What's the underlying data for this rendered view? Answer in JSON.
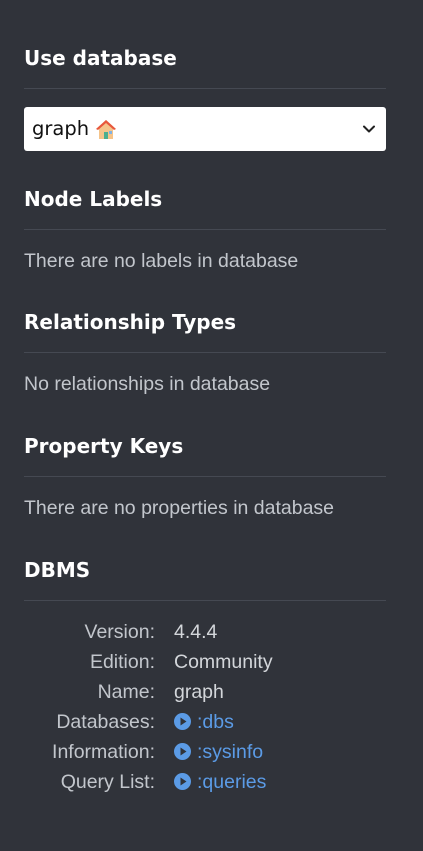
{
  "use_database": {
    "title": "Use database",
    "selected": "graph",
    "selected_icon": "house-icon"
  },
  "node_labels": {
    "title": "Node Labels",
    "empty": "There are no labels in database"
  },
  "relationship_types": {
    "title": "Relationship Types",
    "empty": "No relationships in database"
  },
  "property_keys": {
    "title": "Property Keys",
    "empty": "There are no properties in database"
  },
  "dbms": {
    "title": "DBMS",
    "version_label": "Version:",
    "version": "4.4.4",
    "edition_label": "Edition:",
    "edition": "Community",
    "name_label": "Name:",
    "name": "graph",
    "databases_label": "Databases:",
    "databases_link": ":dbs",
    "information_label": "Information:",
    "information_link": ":sysinfo",
    "query_list_label": "Query List:",
    "query_list_link": ":queries"
  },
  "colors": {
    "background": "#30333a",
    "link": "#5b9be6",
    "house_roof": "#e8573c",
    "house_body": "#f5c48a",
    "house_door": "#4caf8f"
  }
}
